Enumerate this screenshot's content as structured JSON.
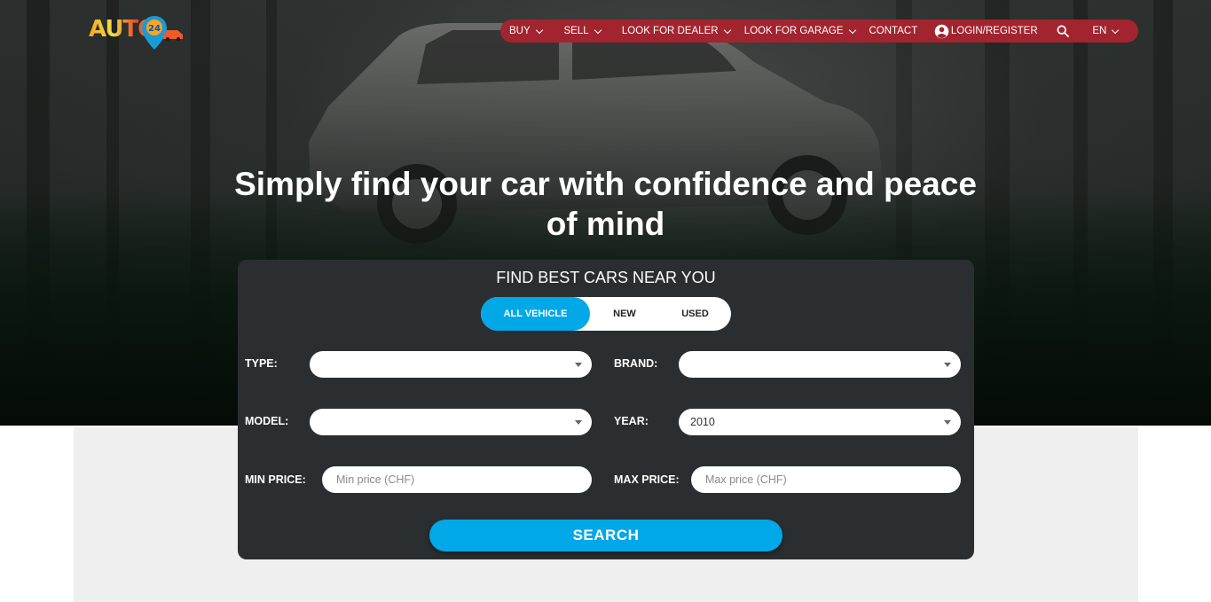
{
  "brand": {
    "logo_text": "AUTO",
    "logo_badge": "24"
  },
  "nav": {
    "items": [
      {
        "label": "BUY",
        "has_dropdown": true
      },
      {
        "label": "SELL",
        "has_dropdown": true
      },
      {
        "label": "LOOK FOR DEALER",
        "has_dropdown": true
      },
      {
        "label": "LOOK FOR GARAGE",
        "has_dropdown": true
      },
      {
        "label": "CONTACT",
        "has_dropdown": false
      }
    ],
    "login_label": "LOGIN/REGISTER",
    "search_icon": "search-icon",
    "language": "EN",
    "color": "#a1242f"
  },
  "hero": {
    "headline": "Simply find your car with confidence and peace of mind"
  },
  "search_card": {
    "title": "FIND BEST CARS NEAR YOU",
    "tabs": [
      {
        "label": "ALL VEHICLE",
        "active": true
      },
      {
        "label": "NEW",
        "active": false
      },
      {
        "label": "USED",
        "active": false
      }
    ],
    "fields": {
      "type": {
        "label": "TYPE:",
        "value": ""
      },
      "brand": {
        "label": "BRAND:",
        "value": ""
      },
      "model": {
        "label": "MODEL:",
        "value": ""
      },
      "year": {
        "label": "YEAR:",
        "value": "2010"
      },
      "min_price": {
        "label": "MIN PRICE:",
        "value": "",
        "placeholder": "Min price (CHF)"
      },
      "max_price": {
        "label": "MAX PRICE:",
        "value": "",
        "placeholder": "Max price (CHF)"
      }
    },
    "search_label": "SEARCH",
    "accent_color": "#00a8e8"
  }
}
